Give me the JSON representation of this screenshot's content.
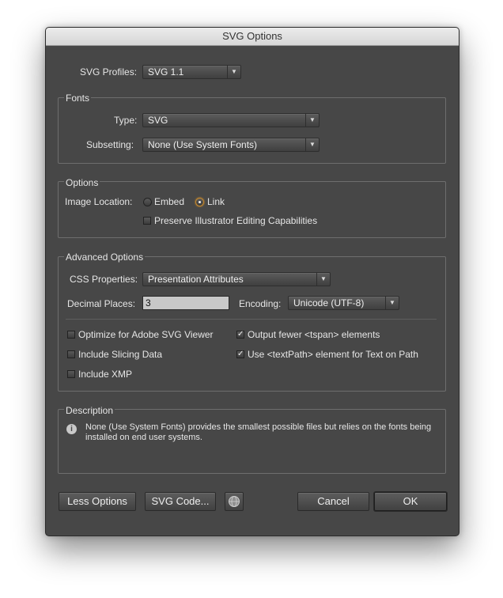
{
  "window": {
    "title": "SVG Options"
  },
  "svg_profiles": {
    "label": "SVG Profiles:",
    "value": "SVG 1.1"
  },
  "fonts": {
    "title": "Fonts",
    "type_label": "Type:",
    "type_value": "SVG",
    "subsetting_label": "Subsetting:",
    "subsetting_value": "None (Use System Fonts)"
  },
  "options": {
    "title": "Options",
    "image_location_label": "Image Location:",
    "embed_label": "Embed",
    "embed_selected": false,
    "link_label": "Link",
    "link_selected": true,
    "preserve_label": "Preserve Illustrator Editing Capabilities",
    "preserve_checked": false
  },
  "advanced": {
    "title": "Advanced Options",
    "css_label": "CSS Properties:",
    "css_value": "Presentation Attributes",
    "decimal_label": "Decimal Places:",
    "decimal_value": "3",
    "encoding_label": "Encoding:",
    "encoding_value": "Unicode (UTF-8)",
    "optimize_label": "Optimize for Adobe SVG Viewer",
    "optimize_checked": false,
    "tspan_label": "Output fewer <tspan> elements",
    "tspan_checked": true,
    "slicing_label": "Include Slicing Data",
    "slicing_checked": false,
    "textpath_label": "Use <textPath> element for Text on Path",
    "textpath_checked": true,
    "xmp_label": "Include XMP",
    "xmp_checked": false
  },
  "description": {
    "title": "Description",
    "line1": "None (Use System Fonts) provides the smallest possible files but relies on the fonts being",
    "line2": "installed on end user systems."
  },
  "buttons": {
    "less_options": "Less Options",
    "svg_code": "SVG Code...",
    "cancel": "Cancel",
    "ok": "OK"
  },
  "icons": {
    "info": "info-icon",
    "web": "globe-icon",
    "dropdown": "chevron-down-icon"
  },
  "colors": {
    "dialog_bg": "#474747",
    "radio_accent": "#c98a2c",
    "field_bg": "#c8c8c8"
  }
}
